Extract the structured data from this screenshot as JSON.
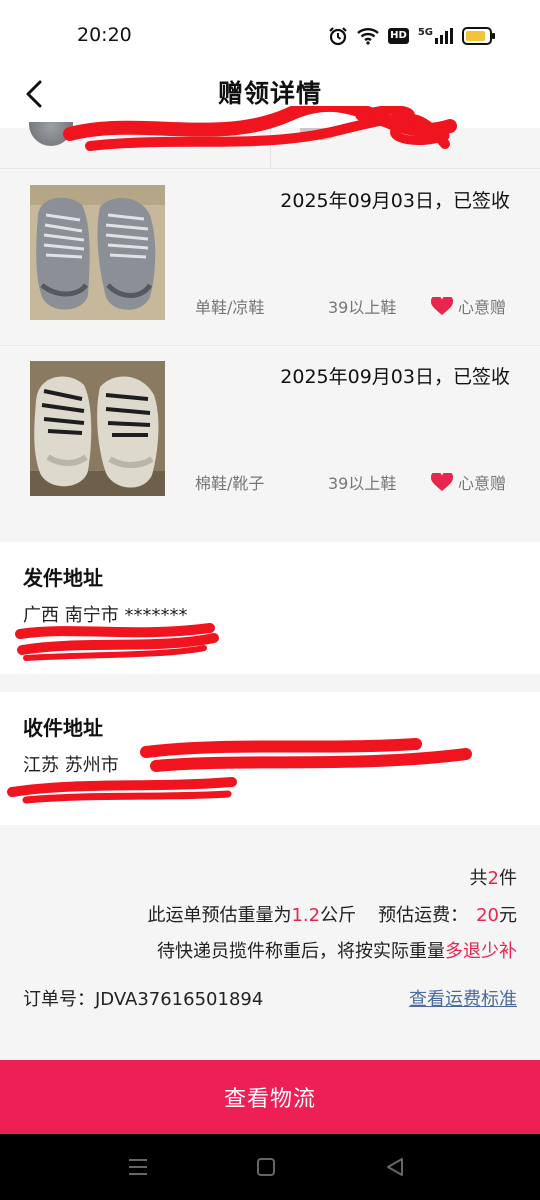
{
  "status_bar": {
    "time": "20:20",
    "icons": [
      "alarm-icon",
      "wifi-icon",
      "hd-icon",
      "signal-5g-icon",
      "battery-icon"
    ],
    "hd_label": "HD",
    "net_label": "5G"
  },
  "header": {
    "title": "赠领详情",
    "back_icon": "chevron-left-icon"
  },
  "items": [
    {
      "date": "2025年09月03日，已签收",
      "category": "单鞋/凉鞋",
      "size": "39以上鞋",
      "tag": "心意赠"
    },
    {
      "date": "2025年09月03日，已签收",
      "category": "棉鞋/靴子",
      "size": "39以上鞋",
      "tag": "心意赠"
    }
  ],
  "sender": {
    "title": "发件地址",
    "region": "广西 南宁市 *******"
  },
  "receiver": {
    "title": "收件地址",
    "region": "江苏 苏州市"
  },
  "summary": {
    "count_prefix": "共",
    "count": "2",
    "count_suffix": "件",
    "weight_prefix": "此运单预估重量为",
    "weight": "1.2",
    "weight_unit": "公斤",
    "fee_label": "预估运费：",
    "fee": "20",
    "fee_unit": "元",
    "note_prefix": "待快递员揽件称重后，将按实际重量",
    "note_highlight": "多退少补",
    "order_label": "订单号：",
    "order_no": "JDVA37616501894",
    "fee_standard_link": "查看运费标准"
  },
  "action": {
    "logistics_button": "查看物流"
  },
  "colors": {
    "accent": "#ee1f55",
    "highlight_text": "#e8244f",
    "link": "#4a6aa0",
    "heart": "#e8244f"
  }
}
